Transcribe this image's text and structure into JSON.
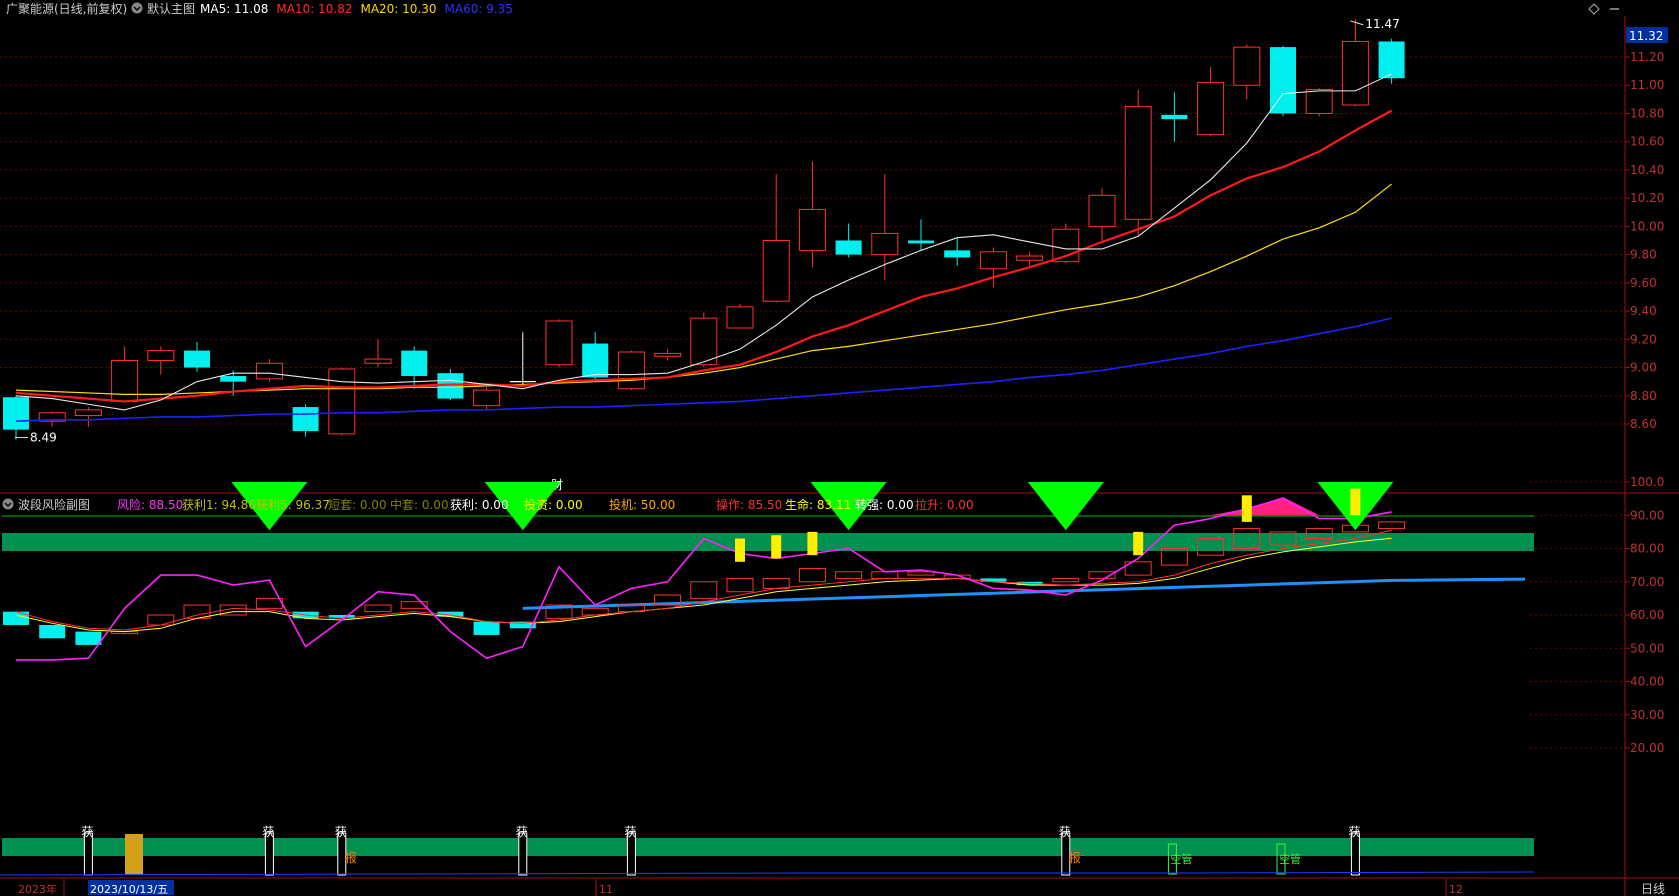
{
  "stock": {
    "name": "广聚能源(日线,前复权)",
    "chart_name": "默认主图",
    "ma": [
      {
        "label": "MA5: 11.08",
        "color": "#ffffff"
      },
      {
        "label": "MA10: 10.82",
        "color": "#ff2a2a"
      },
      {
        "label": "MA20: 10.30",
        "color": "#ffd400"
      },
      {
        "label": "MA60: 9.35",
        "color": "#3030ff"
      }
    ],
    "last_price_tag": "11.32",
    "high_marker": "11.47",
    "low_marker": "8.49",
    "cai_marker": "财"
  },
  "price_axis": [
    "11.20",
    "11.00",
    "10.80",
    "10.60",
    "10.40",
    "10.20",
    "10.00",
    "9.80",
    "9.60",
    "9.40",
    "9.20",
    "9.00",
    "8.80",
    "8.60"
  ],
  "sub": {
    "title": "波段风险副图",
    "indicators": [
      {
        "label": "风险: 88.50",
        "color": "#ff33ff"
      },
      {
        "label": "获利1: 94.86",
        "color": "#c0c000"
      },
      {
        "label": "获利5: 96.37",
        "color": "#c0c000"
      },
      {
        "label": "短套: 0.00",
        "color": "#808000"
      },
      {
        "label": "中套: 0.00",
        "color": "#808000"
      },
      {
        "label": "获利: 0.00",
        "color": "#ffffff"
      },
      {
        "label": "投资: 0.00",
        "color": "#ffff00"
      },
      {
        "label": "投机: 50.00",
        "color": "#ffa500"
      },
      {
        "label": "操作: 85.50",
        "color": "#ff3030"
      },
      {
        "label": "生命: 83.11",
        "color": "#ffff00"
      },
      {
        "label": "转强: 0.00",
        "color": "#ffffff"
      },
      {
        "label": "拉升: 0.00",
        "color": "#ff3030"
      }
    ],
    "axis": [
      "100.0",
      "90.00",
      "80.00",
      "70.00",
      "60.00",
      "50.00",
      "40.00",
      "30.00",
      "20.00"
    ]
  },
  "bottom": {
    "huo_label": "获",
    "bao_label": "报",
    "kongcang_label": "空管",
    "date_axis": [
      "2023年",
      "2023/10/13/五",
      "11",
      "12"
    ],
    "period": "日线"
  },
  "chart_data": {
    "type": "candlestick",
    "ylim": [
      8.45,
      11.45
    ],
    "candles": [
      {
        "o": 8.79,
        "c": 8.56,
        "h": 8.8,
        "l": 8.49
      },
      {
        "o": 8.62,
        "c": 8.68,
        "h": 8.69,
        "l": 8.58
      },
      {
        "o": 8.66,
        "c": 8.7,
        "h": 8.72,
        "l": 8.58
      },
      {
        "o": 8.76,
        "c": 9.05,
        "h": 9.15,
        "l": 8.75
      },
      {
        "o": 9.05,
        "c": 9.12,
        "h": 9.15,
        "l": 8.95
      },
      {
        "o": 9.12,
        "c": 9.0,
        "h": 9.18,
        "l": 8.97
      },
      {
        "o": 8.94,
        "c": 8.9,
        "h": 8.98,
        "l": 8.8
      },
      {
        "o": 8.92,
        "c": 9.03,
        "h": 9.06,
        "l": 8.9
      },
      {
        "o": 8.72,
        "c": 8.55,
        "h": 8.74,
        "l": 8.51
      },
      {
        "o": 8.53,
        "c": 8.99,
        "h": 9.0,
        "l": 8.52
      },
      {
        "o": 9.03,
        "c": 9.06,
        "h": 9.2,
        "l": 9.0
      },
      {
        "o": 9.12,
        "c": 8.94,
        "h": 9.15,
        "l": 8.85
      },
      {
        "o": 8.96,
        "c": 8.78,
        "h": 8.99,
        "l": 8.77
      },
      {
        "o": 8.73,
        "c": 8.84,
        "h": 8.86,
        "l": 8.7
      },
      {
        "o": 8.9,
        "c": 8.9,
        "h": 9.25,
        "l": 8.88
      },
      {
        "o": 9.02,
        "c": 9.33,
        "h": 9.34,
        "l": 9.0
      },
      {
        "o": 9.17,
        "c": 8.93,
        "h": 9.25,
        "l": 8.9
      },
      {
        "o": 8.85,
        "c": 9.11,
        "h": 9.12,
        "l": 8.84
      },
      {
        "o": 9.08,
        "c": 9.1,
        "h": 9.13,
        "l": 9.05
      },
      {
        "o": 9.02,
        "c": 9.35,
        "h": 9.39,
        "l": 9.0
      },
      {
        "o": 9.28,
        "c": 9.43,
        "h": 9.45,
        "l": 9.28
      },
      {
        "o": 9.47,
        "c": 9.9,
        "h": 10.37,
        "l": 9.46
      },
      {
        "o": 9.83,
        "c": 10.12,
        "h": 10.46,
        "l": 9.71
      },
      {
        "o": 9.9,
        "c": 9.8,
        "h": 10.02,
        "l": 9.78
      },
      {
        "o": 9.8,
        "c": 9.95,
        "h": 10.37,
        "l": 9.62
      },
      {
        "o": 9.9,
        "c": 9.88,
        "h": 10.05,
        "l": 9.83
      },
      {
        "o": 9.83,
        "c": 9.78,
        "h": 9.92,
        "l": 9.72
      },
      {
        "o": 9.7,
        "c": 9.82,
        "h": 9.85,
        "l": 9.57
      },
      {
        "o": 9.76,
        "c": 9.79,
        "h": 9.82,
        "l": 9.71
      },
      {
        "o": 9.75,
        "c": 9.98,
        "h": 10.02,
        "l": 9.74
      },
      {
        "o": 10.0,
        "c": 10.22,
        "h": 10.27,
        "l": 9.9
      },
      {
        "o": 10.05,
        "c": 10.85,
        "h": 10.97,
        "l": 9.93
      },
      {
        "o": 10.79,
        "c": 10.76,
        "h": 10.95,
        "l": 10.6
      },
      {
        "o": 10.65,
        "c": 11.02,
        "h": 11.13,
        "l": 10.64
      },
      {
        "o": 11.0,
        "c": 11.27,
        "h": 11.29,
        "l": 10.9
      },
      {
        "o": 11.27,
        "c": 10.8,
        "h": 11.28,
        "l": 10.78
      },
      {
        "o": 10.8,
        "c": 10.97,
        "h": 10.98,
        "l": 10.78
      },
      {
        "o": 10.86,
        "c": 11.31,
        "h": 11.47,
        "l": 10.85
      },
      {
        "o": 11.31,
        "c": 11.05,
        "h": 11.33,
        "l": 11.01
      }
    ],
    "ma5": [
      8.8,
      8.78,
      8.74,
      8.7,
      8.77,
      8.9,
      8.96,
      8.96,
      8.93,
      8.9,
      8.89,
      8.9,
      8.91,
      8.88,
      8.85,
      8.91,
      8.95,
      8.95,
      8.96,
      9.04,
      9.13,
      9.3,
      9.5,
      9.62,
      9.73,
      9.83,
      9.92,
      9.94,
      9.89,
      9.84,
      9.84,
      9.93,
      10.13,
      10.33,
      10.59,
      10.94,
      10.96,
      10.96,
      11.08
    ],
    "ma10": [
      8.82,
      8.8,
      8.78,
      8.76,
      8.78,
      8.8,
      8.83,
      8.85,
      8.87,
      8.86,
      8.86,
      8.87,
      8.88,
      8.88,
      8.87,
      8.9,
      8.91,
      8.92,
      8.93,
      8.98,
      9.02,
      9.11,
      9.22,
      9.3,
      9.4,
      9.5,
      9.56,
      9.64,
      9.71,
      9.79,
      9.89,
      9.98,
      10.07,
      10.22,
      10.34,
      10.42,
      10.53,
      10.68,
      10.82
    ],
    "ma20": [
      8.84,
      8.83,
      8.82,
      8.81,
      8.81,
      8.82,
      8.83,
      8.84,
      8.85,
      8.85,
      8.85,
      8.86,
      8.86,
      8.87,
      8.88,
      8.89,
      8.9,
      8.91,
      8.93,
      8.96,
      9.0,
      9.06,
      9.12,
      9.15,
      9.19,
      9.23,
      9.27,
      9.31,
      9.36,
      9.41,
      9.45,
      9.5,
      9.58,
      9.68,
      9.79,
      9.91,
      9.99,
      10.1,
      10.3
    ],
    "ma60": [
      8.62,
      8.63,
      8.63,
      8.64,
      8.65,
      8.65,
      8.66,
      8.67,
      8.67,
      8.68,
      8.68,
      8.69,
      8.7,
      8.7,
      8.71,
      8.72,
      8.72,
      8.73,
      8.74,
      8.75,
      8.76,
      8.78,
      8.8,
      8.82,
      8.84,
      8.86,
      8.88,
      8.9,
      8.93,
      8.95,
      8.98,
      9.02,
      9.06,
      9.1,
      9.15,
      9.19,
      9.24,
      9.29,
      9.35
    ],
    "sub_ylim": [
      10,
      105
    ],
    "risk": [
      46.5,
      46.5,
      47,
      62,
      72,
      72,
      69,
      70.5,
      50.5,
      58.5,
      67,
      66,
      55,
      47,
      50.5,
      74.5,
      63,
      68,
      70,
      83,
      78.5,
      77,
      78.5,
      80,
      73,
      73.5,
      72,
      68,
      67.5,
      66,
      70.5,
      77,
      87,
      89,
      92,
      95,
      89,
      89,
      91
    ],
    "operate": [
      61,
      58,
      56,
      55.5,
      57,
      60,
      62,
      61.5,
      60,
      59,
      60,
      61,
      60,
      58,
      57.5,
      58.5,
      60,
      61,
      62,
      64,
      66,
      68,
      69,
      70,
      71,
      71,
      71,
      70,
      69.5,
      69,
      69.5,
      70,
      72,
      75.5,
      78,
      80,
      81.5,
      83,
      85.5
    ],
    "life": [
      60,
      57.5,
      55.5,
      55,
      56,
      59,
      61,
      61,
      59,
      58.5,
      59.5,
      60.5,
      59.5,
      58,
      57.5,
      58,
      59.5,
      61,
      62,
      63,
      65,
      67,
      68,
      69,
      70,
      70.5,
      71,
      70,
      69,
      69,
      69,
      69.5,
      71,
      74,
      77,
      79,
      80.5,
      82,
      83.1
    ],
    "bars_sub": [
      {
        "o": 61,
        "c": 57,
        "up": false
      },
      {
        "o": 57,
        "c": 53,
        "up": false
      },
      {
        "o": 55,
        "c": 51,
        "up": false
      },
      {
        "o": 55,
        "c": 55,
        "up": true
      },
      {
        "o": 57,
        "c": 60,
        "up": true
      },
      {
        "o": 59,
        "c": 63,
        "up": true
      },
      {
        "o": 60,
        "c": 63,
        "up": true
      },
      {
        "o": 62,
        "c": 65,
        "up": true
      },
      {
        "o": 61,
        "c": 59,
        "up": false
      },
      {
        "o": 60,
        "c": 59,
        "up": false
      },
      {
        "o": 61,
        "c": 63,
        "up": true
      },
      {
        "o": 62,
        "c": 64,
        "up": true
      },
      {
        "o": 61,
        "c": 59.5,
        "up": false
      },
      {
        "o": 58,
        "c": 54,
        "up": false
      },
      {
        "o": 58,
        "c": 56,
        "up": false
      },
      {
        "o": 59,
        "c": 63,
        "up": true
      },
      {
        "o": 60,
        "c": 62,
        "up": true
      },
      {
        "o": 61,
        "c": 63,
        "up": true
      },
      {
        "o": 63,
        "c": 66,
        "up": true
      },
      {
        "o": 65,
        "c": 70,
        "up": true
      },
      {
        "o": 67,
        "c": 71,
        "up": true
      },
      {
        "o": 68,
        "c": 71,
        "up": true
      },
      {
        "o": 70,
        "c": 74,
        "up": true
      },
      {
        "o": 71,
        "c": 73,
        "up": true
      },
      {
        "o": 71,
        "c": 73,
        "up": true
      },
      {
        "o": 72,
        "c": 73,
        "up": true
      },
      {
        "o": 71,
        "c": 72,
        "up": true
      },
      {
        "o": 70,
        "c": 71,
        "up": false
      },
      {
        "o": 69,
        "c": 70,
        "up": false
      },
      {
        "o": 70,
        "c": 71,
        "up": true
      },
      {
        "o": 71,
        "c": 73,
        "up": true
      },
      {
        "o": 72,
        "c": 76,
        "up": true
      },
      {
        "o": 75,
        "c": 80,
        "up": true
      },
      {
        "o": 78,
        "c": 83,
        "up": true
      },
      {
        "o": 80,
        "c": 86,
        "up": true
      },
      {
        "o": 81,
        "c": 85,
        "up": true
      },
      {
        "o": 83,
        "c": 86,
        "up": true
      },
      {
        "o": 85,
        "c": 87,
        "up": true
      },
      {
        "o": 86,
        "c": 88,
        "up": true
      }
    ],
    "green_triangles_at": [
      7,
      14,
      23,
      29,
      37
    ],
    "yellow_bars_at": [
      {
        "i": 20,
        "lo": 76,
        "hi": 83
      },
      {
        "i": 21,
        "lo": 77,
        "hi": 84
      },
      {
        "i": 22,
        "lo": 78,
        "hi": 85
      },
      {
        "i": 31,
        "lo": 78,
        "hi": 85
      },
      {
        "i": 34,
        "lo": 88,
        "hi": 96
      },
      {
        "i": 37,
        "lo": 90,
        "hi": 98
      }
    ],
    "huo_at": [
      2,
      7,
      9,
      14,
      17,
      29,
      37
    ],
    "bao_at": [
      3,
      9,
      29
    ],
    "kongcang_at": [
      32,
      35
    ]
  }
}
